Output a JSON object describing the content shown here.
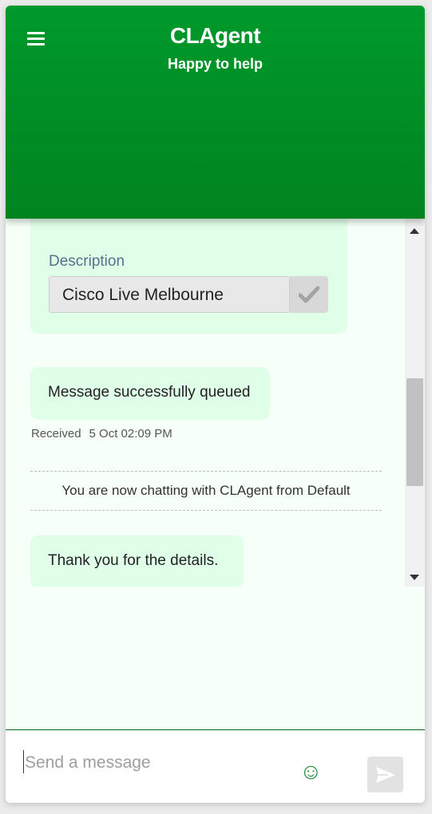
{
  "header": {
    "title": "CLAgent",
    "subtitle": "Happy to help",
    "menu_icon": "hamburger-menu-icon",
    "color": "#00922a"
  },
  "form": {
    "field_label": "Description",
    "field_value": "Cisco Live Melbourne",
    "check_icon": "checkmark-icon"
  },
  "messages": [
    {
      "text": "Message successfully queued"
    },
    {
      "text": "Thank you for the details."
    }
  ],
  "message_meta": {
    "status": "Received",
    "timestamp": "5 Oct 02:09 PM"
  },
  "system_note": "You are now chatting with CLAgent from Default",
  "composer": {
    "placeholder": "Send a message",
    "emoji_icon": "smiley-icon",
    "send_icon": "send-arrow-icon",
    "accent": "#1e8e3e"
  },
  "colors": {
    "bubble_bg": "#e0ffe9",
    "chat_bg": "#f6fff8",
    "label": "#567089"
  }
}
